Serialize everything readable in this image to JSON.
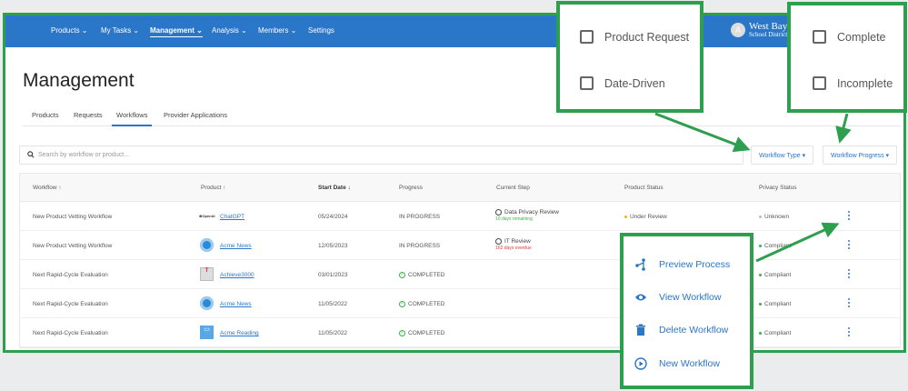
{
  "nav": {
    "items": [
      {
        "label": "Products ⌄"
      },
      {
        "label": "My Tasks ⌄"
      },
      {
        "label": "Management ⌄",
        "active": true
      },
      {
        "label": "Analysis ⌄"
      },
      {
        "label": "Members ⌄"
      },
      {
        "label": "Settings"
      }
    ],
    "org": {
      "initial": "A",
      "name": "West Bay",
      "sub": "School District"
    }
  },
  "page": {
    "title": "Management"
  },
  "tabs": [
    {
      "label": "Products"
    },
    {
      "label": "Requests"
    },
    {
      "label": "Workflows",
      "active": true
    },
    {
      "label": "Provider Applications"
    }
  ],
  "search": {
    "placeholder": "Search by workflow or product..."
  },
  "filters": {
    "type": "Workflow Type ▾",
    "progress": "Workflow Progress ▾"
  },
  "table": {
    "headers": [
      "Workflow ↑",
      "Product ↑",
      "Start Date ↓",
      "Progress",
      "Current Step",
      "Product Status",
      "Privacy Status"
    ],
    "rows": [
      {
        "workflow": "New Product Vetting Workflow",
        "product": "ChatGPT",
        "logo": "openai",
        "date": "05/24/2024",
        "progress": "IN PROGRESS",
        "step": "Data Privacy Review",
        "step_sub": "10 days remaining",
        "step_sub_color": "#3cb04a",
        "product_status": "Under Review",
        "product_status_color": "#f5b800",
        "privacy": "Unknown",
        "privacy_color": "#bbbbbb"
      },
      {
        "workflow": "New Product Vetting Workflow",
        "product": "Acme News",
        "logo": "globe",
        "date": "12/05/2023",
        "progress": "IN PROGRESS",
        "step": "IT Review",
        "step_sub": "162 days overdue",
        "step_sub_color": "#e53935",
        "product_status": "",
        "privacy": "Compliant",
        "privacy_color": "#3cb04a"
      },
      {
        "workflow": "Next Rapid-Cycle Evaluation",
        "product": "Achieve3000",
        "logo": "achieve",
        "date": "03/01/2023",
        "progress": "COMPLETED",
        "step": "",
        "product_status": "",
        "privacy": "Compliant",
        "privacy_color": "#3cb04a"
      },
      {
        "workflow": "Next Rapid-Cycle Evaluation",
        "product": "Acme News",
        "logo": "globe",
        "date": "11/05/2022",
        "progress": "COMPLETED",
        "step": "",
        "product_status": "",
        "privacy": "Compliant",
        "privacy_color": "#3cb04a"
      },
      {
        "workflow": "Next Rapid-Cycle Evaluation",
        "product": "Acme Reading",
        "logo": "book",
        "date": "11/05/2022",
        "progress": "COMPLETED",
        "step": "",
        "product_status": "",
        "privacy": "Compliant",
        "privacy_color": "#3cb04a"
      }
    ]
  },
  "type_popup": {
    "options": [
      "Product Request",
      "Date-Driven"
    ]
  },
  "progress_popup": {
    "options": [
      "Complete",
      "Incomplete"
    ]
  },
  "row_menu": {
    "items": [
      {
        "label": "Preview Process",
        "icon": "flow-icon"
      },
      {
        "label": "View Workflow",
        "icon": "eye-icon"
      },
      {
        "label": "Delete Workflow",
        "icon": "trash-icon"
      },
      {
        "label": "New Workflow",
        "icon": "play-circle-icon"
      }
    ]
  },
  "colors": {
    "accent": "#2a76c9",
    "highlight": "#2e9e4f"
  }
}
